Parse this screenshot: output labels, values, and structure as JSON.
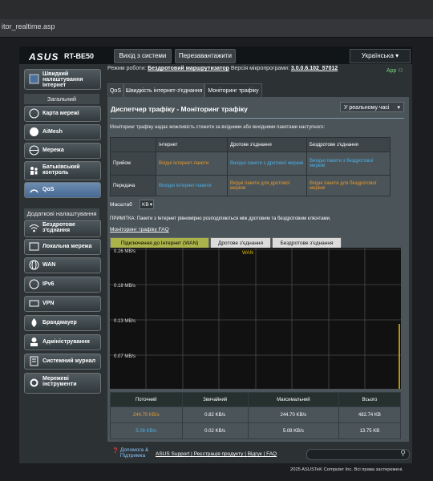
{
  "browser": {
    "url": "itor_realtime.asp"
  },
  "header": {
    "logo": "ASUS",
    "model": "RT-BE50",
    "logout_label": "Вихід з системи",
    "reboot_label": "Перезавантажити",
    "language": "Українська",
    "mode_label": "Режим роботи:",
    "mode_value": "Бездротовий маршрутизатор",
    "fw_label": "Версія мікропрограми:",
    "fw_value": "3.0.0.6.102_57012",
    "app_label": "App"
  },
  "sidebar": {
    "quick": "Швидкий налаштування Інтернет",
    "general": "Загальний",
    "items": [
      "Карта мережі",
      "AiMesh",
      "Мережа",
      "Батьківський контроль",
      "QoS"
    ],
    "advanced": "Додаткові налаштування",
    "adv_items": [
      "Бездротове з'єднання",
      "Локальна мережа",
      "WAN",
      "IPv6",
      "VPN",
      "Брандмауер",
      "Адміністрування",
      "Системний журнал",
      "Мережеві інструменти"
    ]
  },
  "tabs": [
    "QoS",
    "Швидкість інтернет-з'єднання",
    "Моніторинг трафіку"
  ],
  "page": {
    "title": "Диспетчер трафіку - Моніторинг трафіку",
    "mode_select": "У реальному часі",
    "description": "Моніторинг трафіку надає можливість стежити за вхідними або вихідними пакетами наступного:",
    "legend_headers": [
      "Інтернет",
      "Дротове з'єднання",
      "Бездротове з'єднання"
    ],
    "rx_label": "Прийом",
    "tx_label": "Передача",
    "rx_cells": [
      "Вхідні Інтернет-пакети",
      "Вихідні пакети з дротової мережі",
      "Вихідні пакети з бездротової мережі"
    ],
    "tx_cells": [
      "Вихідні Інтернет-пакети",
      "Вхідні пакети для дротової мережі",
      "Вхідні пакети для бездротової мережі"
    ],
    "scale_label": "Масштаб",
    "scale_value": "KB",
    "note": "ПРИМІТКА: Пакети з Інтернет рівномірно розподіляються між дротовим та бездротовим клієнтами.",
    "faq": "Моніторинг трафіку FAQ",
    "graph_tabs": [
      "Підключення до Інтернет (WAN)",
      "Дротове з'єднання",
      "Бездротове з'єднання"
    ],
    "graph_ylabels": [
      "0.26 MB/s",
      "0.18 MB/s",
      "0.13 MB/s",
      "0.07 MB/s"
    ],
    "graph_legend": "WAN",
    "stats_headers": [
      "Поточний",
      "Звичайний",
      "Максимальний",
      "Всього"
    ],
    "stats_rows": [
      [
        "244.70 KB/s",
        "0.82 KB/s",
        "244.70 KB/s",
        "482.74 KB"
      ],
      [
        "5.08 KB/s",
        "0.02 KB/s",
        "5.08 KB/s",
        "13.75 KB"
      ]
    ]
  },
  "footer": {
    "help": "Допомога & Підтримка",
    "links": [
      "ASUS Support",
      "Реєстрація продукту",
      "Відгук",
      "FAQ"
    ],
    "copyright": "2025 ASUSTeK Computer Inc. Всі права застережені."
  },
  "colors": {
    "accent_blue": "#4fb0e6",
    "accent_orange": "#e89a32",
    "graph_line": "#e8c000"
  }
}
